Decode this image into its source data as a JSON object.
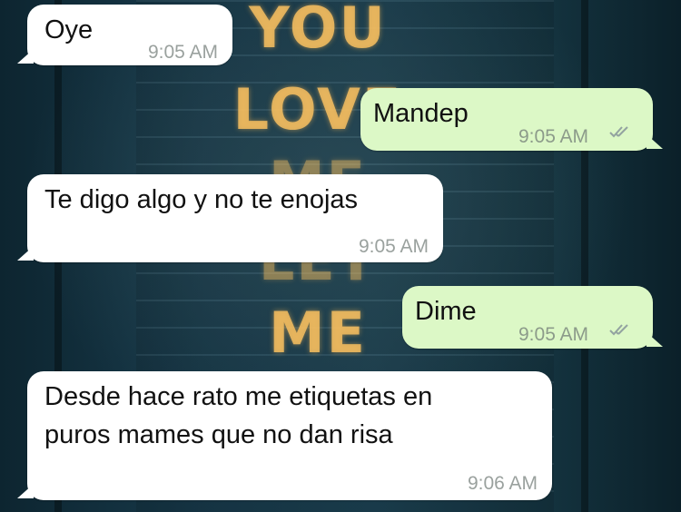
{
  "wallpaper": {
    "sign_lines": [
      "YOU",
      "LOVE",
      "ME",
      "LET",
      "ME"
    ]
  },
  "messages": [
    {
      "direction": "incoming",
      "text": "Oye",
      "time": "9:05 AM"
    },
    {
      "direction": "outgoing",
      "text": "Mandep",
      "time": "9:05 AM",
      "status": "read"
    },
    {
      "direction": "incoming",
      "text": "Te digo algo y no te enojas",
      "time": "9:05 AM"
    },
    {
      "direction": "outgoing",
      "text": "Dime",
      "time": "9:05 AM",
      "status": "read"
    },
    {
      "direction": "incoming",
      "lines": [
        "Desde hace rato me etiquetas en",
        "puros mames que no dan risa"
      ],
      "time": "9:06 AM"
    }
  ],
  "colors": {
    "incoming_bubble": "#ffffff",
    "outgoing_bubble": "#dcf8c6",
    "read_tick": "#93a3a0"
  },
  "icons": {
    "read_status": "double-check-icon"
  }
}
